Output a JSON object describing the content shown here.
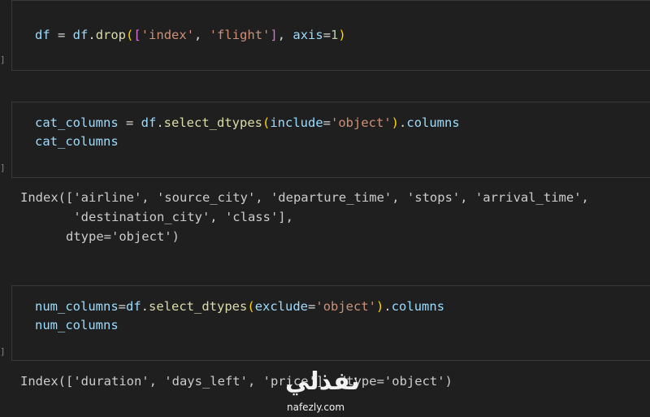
{
  "cells": [
    {
      "code": [
        "df = df.drop(['index', 'flight'], axis=1)"
      ],
      "output": []
    },
    {
      "code": [
        "cat_columns = df.select_dtypes(include='object').columns",
        "cat_columns"
      ],
      "output": [
        "Index(['airline', 'source_city', 'departure_time', 'stops', 'arrival_time',",
        "       'destination_city', 'class'],",
        "      dtype='object')"
      ]
    },
    {
      "code": [
        "num_columns=df.select_dtypes(exclude='object').columns",
        "num_columns"
      ],
      "output": [
        "Index(['duration', 'days_left', 'price'], dtype='object')"
      ]
    }
  ],
  "gutter_marker": "]",
  "watermark": {
    "logo": "نفذلي",
    "url": "nafezly.com"
  },
  "colors": {
    "background": "#1f1f1f",
    "cell_border": "#3a3a3a",
    "variable": "#9cdcfe",
    "function": "#dcdcaa",
    "string": "#ce9178",
    "number": "#b5cea8",
    "bracket_level1": "#ffd700",
    "bracket_level2": "#da70d6"
  }
}
